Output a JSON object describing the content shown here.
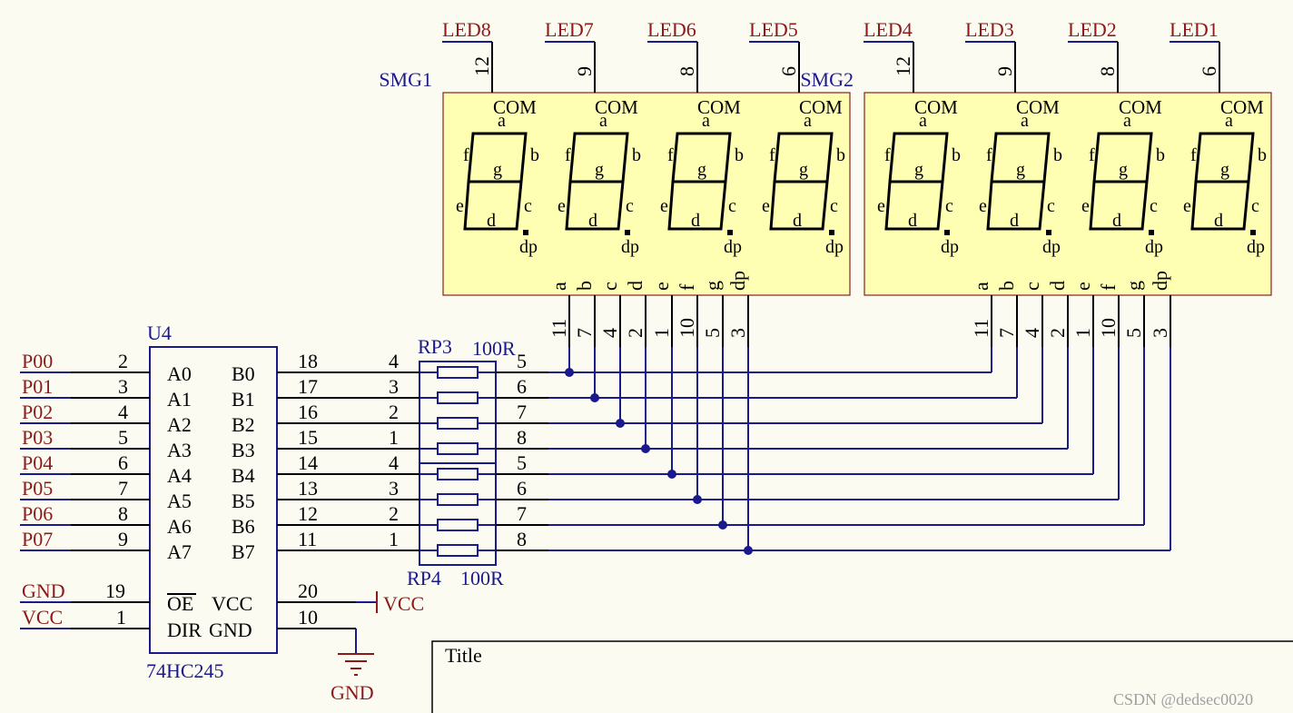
{
  "led_labels": [
    "LED8",
    "LED7",
    "LED6",
    "LED5",
    "LED4",
    "LED3",
    "LED2",
    "LED1"
  ],
  "com_pins": [
    "12",
    "9",
    "8",
    "6",
    "12",
    "9",
    "8",
    "6"
  ],
  "displays": [
    {
      "designator": "SMG1",
      "digit_com_label": "COM"
    },
    {
      "designator": "SMG2",
      "digit_com_label": "COM"
    }
  ],
  "segment_letters": {
    "a": "a",
    "b": "b",
    "c": "c",
    "d": "d",
    "e": "e",
    "f": "f",
    "g": "g",
    "dp": "dp"
  },
  "segment_pin_labels": [
    "a",
    "b",
    "c",
    "d",
    "e",
    "f",
    "g",
    "dp"
  ],
  "segment_pin_numbers": [
    "11",
    "7",
    "4",
    "2",
    "1",
    "10",
    "5",
    "3"
  ],
  "ic": {
    "designator": "U4",
    "part": "74HC245",
    "net_labels": [
      "P00",
      "P01",
      "P02",
      "P03",
      "P04",
      "P05",
      "P06",
      "P07"
    ],
    "a_pin_numbers": [
      "2",
      "3",
      "4",
      "5",
      "6",
      "7",
      "8",
      "9"
    ],
    "a_pin_names": [
      "A0",
      "A1",
      "A2",
      "A3",
      "A4",
      "A5",
      "A6",
      "A7"
    ],
    "b_pin_names": [
      "B0",
      "B1",
      "B2",
      "B3",
      "B4",
      "B5",
      "B6",
      "B7"
    ],
    "b_pin_numbers": [
      "18",
      "17",
      "16",
      "15",
      "14",
      "13",
      "12",
      "11"
    ],
    "oe_net": "GND",
    "oe_pin": "19",
    "oe_name": "OE",
    "dir_net": "VCC",
    "dir_pin": "1",
    "dir_name": "DIR",
    "vcc_name": "VCC",
    "vcc_pin": "20",
    "gnd_name": "GND",
    "gnd_pin": "10"
  },
  "resistor_arrays": [
    {
      "designator": "RP3",
      "value": "100R",
      "left_pins": [
        "4",
        "3",
        "2",
        "1"
      ],
      "right_pins": [
        "5",
        "6",
        "7",
        "8"
      ]
    },
    {
      "designator": "RP4",
      "value": "100R",
      "left_pins": [
        "4",
        "3",
        "2",
        "1"
      ],
      "right_pins": [
        "5",
        "6",
        "7",
        "8"
      ]
    }
  ],
  "power": {
    "vcc_label": "VCC",
    "gnd_label": "GND"
  },
  "title_block": {
    "title_label": "Title"
  },
  "watermark": "CSDN @dedsec0020",
  "colors": {
    "wire": "#1a1a8c",
    "net_label": "#8b1a1a",
    "component_fill": "#ffffb4",
    "component_border": "#8b2020",
    "background": "#fcfbf2"
  }
}
